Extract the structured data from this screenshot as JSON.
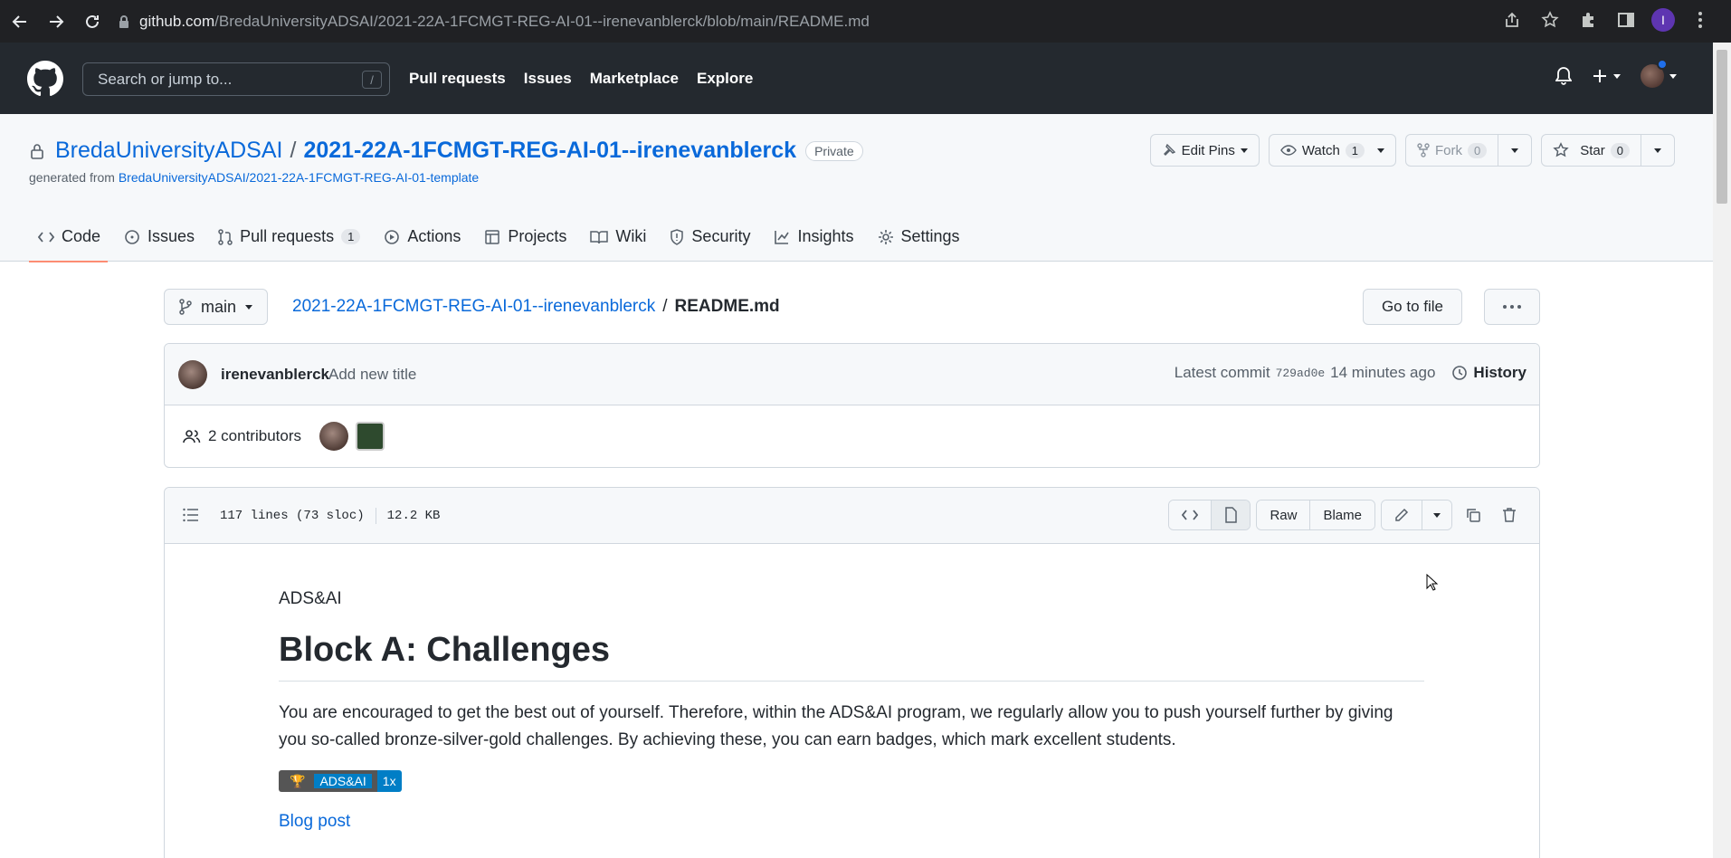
{
  "browser": {
    "url_host": "github.com",
    "url_path": "/BredaUniversityADSAI/2021-22A-1FCMGT-REG-AI-01--irenevanblerck/blob/main/README.md",
    "profile_initial": "I"
  },
  "github_header": {
    "search_placeholder": "Search or jump to...",
    "search_shortcut": "/",
    "nav": [
      "Pull requests",
      "Issues",
      "Marketplace",
      "Explore"
    ]
  },
  "repo": {
    "owner": "BredaUniversityADSAI",
    "name": "2021-22A-1FCMGT-REG-AI-01--irenevanblerck",
    "visibility": "Private",
    "generated_from_prefix": "generated from",
    "generated_from_link": "BredaUniversityADSAI/2021-22A-1FCMGT-REG-AI-01-template",
    "actions": {
      "edit_pins": "Edit Pins",
      "watch": "Watch",
      "watch_count": "1",
      "fork": "Fork",
      "fork_count": "0",
      "star": "Star",
      "star_count": "0"
    },
    "tabs": [
      {
        "label": "Code",
        "active": true
      },
      {
        "label": "Issues"
      },
      {
        "label": "Pull requests",
        "count": "1"
      },
      {
        "label": "Actions"
      },
      {
        "label": "Projects"
      },
      {
        "label": "Wiki"
      },
      {
        "label": "Security"
      },
      {
        "label": "Insights"
      },
      {
        "label": "Settings"
      }
    ]
  },
  "file_nav": {
    "branch": "main",
    "repo_link": "2021-22A-1FCMGT-REG-AI-01--irenevanblerck",
    "separator": "/",
    "file_name": "README.md",
    "goto_file": "Go to file"
  },
  "commit": {
    "author": "irenevanblerck",
    "message": "Add new title",
    "latest_label": "Latest commit",
    "sha": "729ad0e",
    "time": "14 minutes ago",
    "history": "History",
    "contributors": "2 contributors"
  },
  "file": {
    "lines": "117 lines (73 sloc)",
    "size": "12.2 KB",
    "raw": "Raw",
    "blame": "Blame"
  },
  "readme": {
    "top_text": "ADS&AI",
    "heading": "Block A: Challenges",
    "paragraph": "You are encouraged to get the best out of yourself. Therefore, within the ADS&AI program, we regularly allow you to push yourself further by giving you so-called bronze-silver-gold challenges. By achieving these, you can earn badges, which mark excellent students.",
    "badge_left": "ADS&AI",
    "badge_right": "1x",
    "link": "Blog post"
  },
  "colors": {
    "gh_header": "#24292f",
    "link": "#0969da",
    "tab_underline": "#fd8c73",
    "badge_blue": "#007ec6"
  }
}
